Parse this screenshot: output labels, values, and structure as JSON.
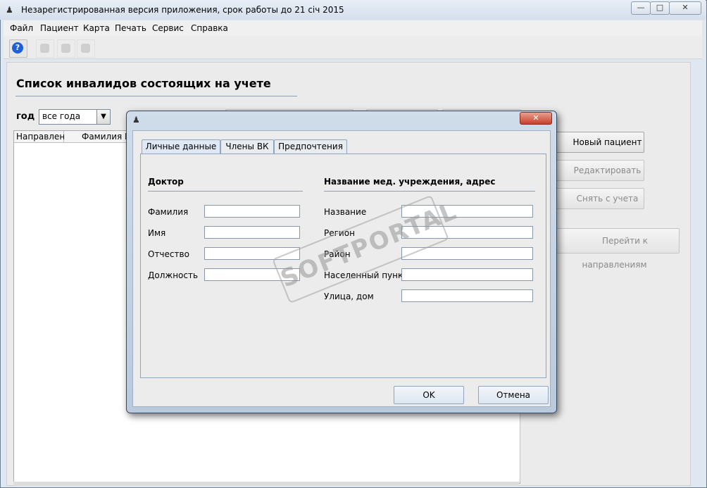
{
  "window": {
    "title": "Незарегистрированная версия приложения, срок работы до 21 січ 2015"
  },
  "menu": [
    "Файл",
    "Пациент",
    "Карта",
    "Печать",
    "Сервис",
    "Справка"
  ],
  "main": {
    "heading": "Список инвалидов состоящих на учете",
    "year_label": "год",
    "year_value": "все года",
    "columns": [
      "Направлен",
      "Фамилия И"
    ]
  },
  "side_buttons": {
    "new_patient": "Новый пациент",
    "edit": "Редактировать",
    "deregister": "Снять с учета",
    "referrals": "Перейти к направлениям"
  },
  "dialog": {
    "tabs": [
      "Личные данные",
      "Члены ВК",
      "Предпочтения"
    ],
    "doctor_section": "Доктор",
    "doctor_fields": {
      "surname": "Фамилия",
      "name": "Имя",
      "patronymic": "Отчество",
      "position": "Должность"
    },
    "institution_section": "Название мед. учреждения, адрес",
    "institution_fields": {
      "name": "Название",
      "region": "Регион",
      "district": "Район",
      "locality": "Населенный пункт",
      "street": "Улица, дом"
    },
    "ok": "OK",
    "cancel": "Отмена"
  },
  "watermark": "SOFTPORTAL",
  "icons": {
    "app": "stethoscope-icon",
    "help": "help-icon"
  }
}
